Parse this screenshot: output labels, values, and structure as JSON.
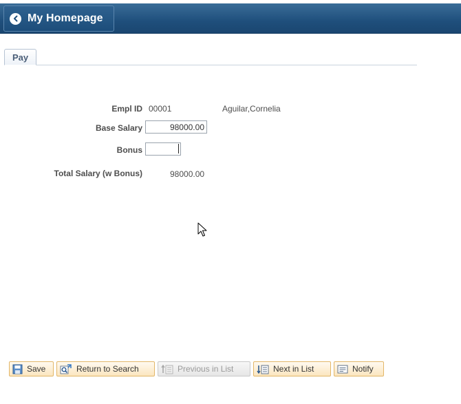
{
  "header": {
    "home_label": "My Homepage"
  },
  "tabs": [
    {
      "label": "Pay"
    }
  ],
  "form": {
    "empl_id_label": "Empl ID",
    "empl_id_value": "00001",
    "employee_name": "Aguilar,Cornelia",
    "base_salary_label": "Base Salary",
    "base_salary_value": "98000.00",
    "bonus_label": "Bonus",
    "bonus_value": "",
    "total_salary_label": "Total Salary (w Bonus)",
    "total_salary_value": "98000.00"
  },
  "toolbar": {
    "save_label": "Save",
    "return_label": "Return to Search",
    "previous_label": "Previous in List",
    "next_label": "Next in List",
    "notify_label": "Notify"
  },
  "icons": {
    "home_back": "chevron-left-icon",
    "save": "save-icon",
    "return": "return-to-search-icon",
    "previous": "previous-in-list-icon",
    "next": "next-in-list-icon",
    "notify": "notify-icon"
  },
  "colors": {
    "header_bg": "#1f4f7c",
    "tab_text": "#4a5e78",
    "toolbar_button_bg": "#fbe6bf",
    "toolbar_button_border": "#e2b667"
  }
}
